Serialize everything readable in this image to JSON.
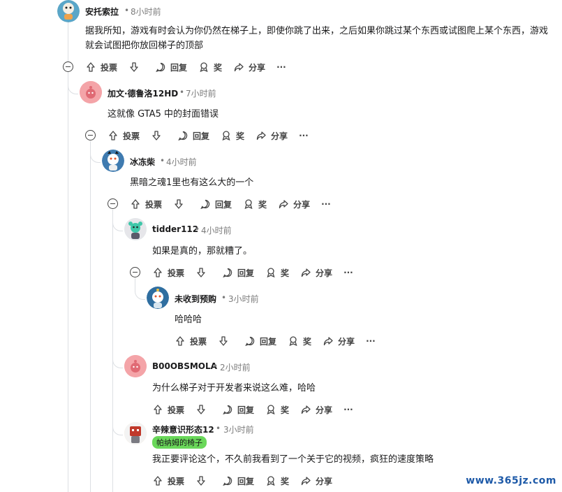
{
  "actions": {
    "upvote": "投票",
    "reply": "回复",
    "award": "奖",
    "share": "分享",
    "more": "···"
  },
  "comments": [
    {
      "author": "安托索拉",
      "time": "8小时前",
      "text": "据我所知，游戏有时会认为你仍然在梯子上，即使你跳了出来，之后如果你跳过某个东西或试图爬上某个东西，游戏就会试图把你放回梯子的顶部"
    },
    {
      "author": "加文·德鲁洛12HD",
      "time": "7小时前",
      "text": "这就像 GTA5 中的封面错误"
    },
    {
      "author": "冰冻柴",
      "time": "4小时前",
      "text": "黑暗之魂1里也有这么大的一个"
    },
    {
      "author": "tidder112",
      "time": "4小时前",
      "text": "如果是真的，那就糟了。"
    },
    {
      "author": "未收到预购",
      "time": "3小时前",
      "text": "哈哈哈"
    },
    {
      "author": "B00OBSMOLA",
      "time": "2小时前",
      "text": "为什么梯子对于开发者来说这么难，哈哈"
    },
    {
      "author": "辛辣意识形态12",
      "time": "3小时前",
      "flair": "帕纳姆的椅子",
      "text": "我正要评论这个，不久前我看到了一个关于它的视频，疯狂的速度策略"
    }
  ],
  "separator": "•",
  "watermark": "www.365jz.com",
  "colors": {
    "flair_bg": "#6ad85a",
    "thread_line": "#dcdfe3",
    "watermark": "#1e5aa8"
  }
}
